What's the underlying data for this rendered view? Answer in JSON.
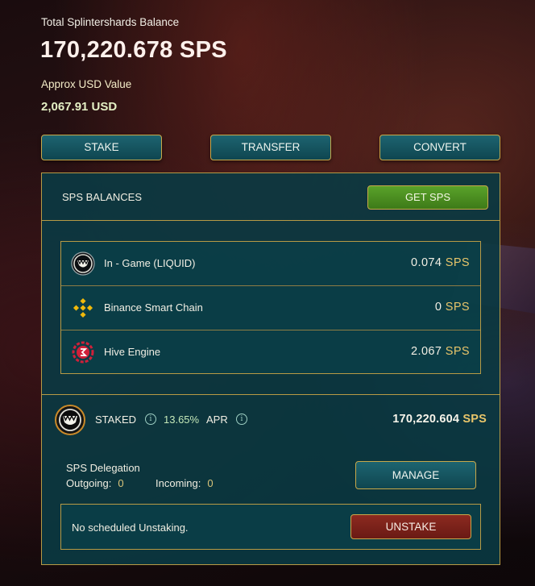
{
  "header": {
    "total_label": "Total Splintershards Balance",
    "total_value": "170,220.678 SPS",
    "usd_label": "Approx USD Value",
    "usd_value": "2,067.91 USD"
  },
  "actions": {
    "stake": "STAKE",
    "transfer": "TRANSFER",
    "convert": "CONVERT"
  },
  "balances": {
    "title": "SPS BALANCES",
    "get_sps": "GET SPS",
    "rows": [
      {
        "label": "In - Game (LIQUID)",
        "amount": "0.074",
        "unit": "SPS",
        "icon": "splinterlands-monster-icon"
      },
      {
        "label": "Binance Smart Chain",
        "amount": "0",
        "unit": "SPS",
        "icon": "binance-icon"
      },
      {
        "label": "Hive Engine",
        "amount": "2.067",
        "unit": "SPS",
        "icon": "hive-engine-icon"
      }
    ]
  },
  "staked": {
    "label": "STAKED",
    "apr_value": "13.65%",
    "apr_label": "APR",
    "amount": "170,220.604",
    "unit": "SPS"
  },
  "delegation": {
    "title": "SPS Delegation",
    "outgoing_label": "Outgoing:",
    "outgoing_value": "0",
    "incoming_label": "Incoming:",
    "incoming_value": "0",
    "manage": "MANAGE"
  },
  "unstaking": {
    "status": "No scheduled Unstaking.",
    "button": "UNSTAKE"
  },
  "colors": {
    "panel": "#0a3a42",
    "border_gold": "#b79a45",
    "sps_gold": "#e8c56a",
    "get_sps_green": "#4a8e22",
    "unstake_red": "#7a2218"
  }
}
